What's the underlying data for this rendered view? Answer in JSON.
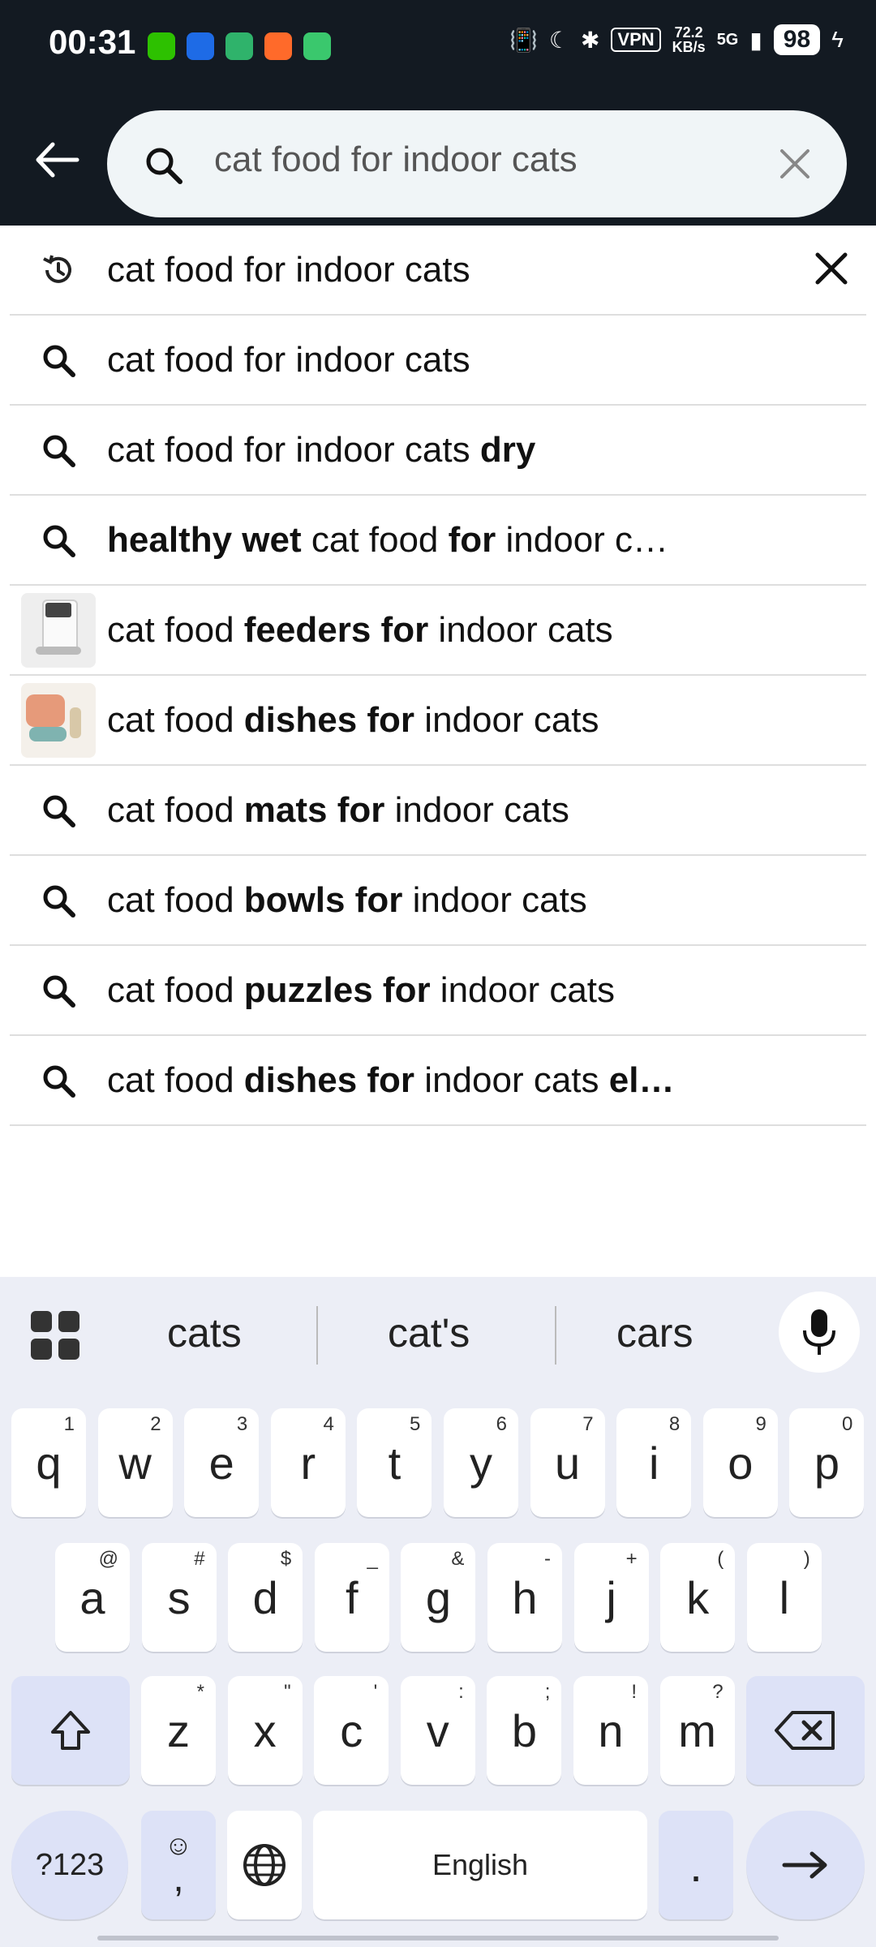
{
  "status_bar": {
    "time": "00:31",
    "vpn": "VPN",
    "speed_value": "72.2",
    "speed_unit": "KB/s",
    "network": "5G",
    "battery": "98"
  },
  "search": {
    "query": "cat food for indoor cats"
  },
  "suggestions": [
    {
      "type": "history",
      "parts": [
        {
          "t": "cat food for indoor cats",
          "b": false
        }
      ],
      "trailing": "remove"
    },
    {
      "type": "search",
      "parts": [
        {
          "t": "cat food for indoor cats",
          "b": false
        }
      ]
    },
    {
      "type": "search",
      "parts": [
        {
          "t": "cat food for indoor cats ",
          "b": false
        },
        {
          "t": "dry",
          "b": true
        }
      ]
    },
    {
      "type": "search",
      "parts": [
        {
          "t": "healthy wet",
          "b": true
        },
        {
          "t": " cat food ",
          "b": false
        },
        {
          "t": "for",
          "b": true
        },
        {
          "t": " indoor c…",
          "b": false
        }
      ]
    },
    {
      "type": "image-feeder",
      "parts": [
        {
          "t": "cat food ",
          "b": false
        },
        {
          "t": "feeders for",
          "b": true
        },
        {
          "t": " indoor cats",
          "b": false
        }
      ]
    },
    {
      "type": "image-dish",
      "parts": [
        {
          "t": "cat food ",
          "b": false
        },
        {
          "t": "dishes for",
          "b": true
        },
        {
          "t": " indoor cats",
          "b": false
        }
      ]
    },
    {
      "type": "search",
      "parts": [
        {
          "t": "cat food ",
          "b": false
        },
        {
          "t": "mats for",
          "b": true
        },
        {
          "t": " indoor cats",
          "b": false
        }
      ]
    },
    {
      "type": "search",
      "parts": [
        {
          "t": "cat food ",
          "b": false
        },
        {
          "t": "bowls for",
          "b": true
        },
        {
          "t": " indoor cats",
          "b": false
        }
      ]
    },
    {
      "type": "search",
      "parts": [
        {
          "t": "cat food ",
          "b": false
        },
        {
          "t": "puzzles for",
          "b": true
        },
        {
          "t": " indoor cats",
          "b": false
        }
      ]
    },
    {
      "type": "search",
      "parts": [
        {
          "t": "cat food ",
          "b": false
        },
        {
          "t": "dishes for",
          "b": true
        },
        {
          "t": " indoor cats ",
          "b": false
        },
        {
          "t": "el…",
          "b": true
        }
      ]
    }
  ],
  "keyboard": {
    "suggestions": [
      "cats",
      "cat's",
      "cars"
    ],
    "row1": [
      [
        "q",
        "1"
      ],
      [
        "w",
        "2"
      ],
      [
        "e",
        "3"
      ],
      [
        "r",
        "4"
      ],
      [
        "t",
        "5"
      ],
      [
        "y",
        "6"
      ],
      [
        "u",
        "7"
      ],
      [
        "i",
        "8"
      ],
      [
        "o",
        "9"
      ],
      [
        "p",
        "0"
      ]
    ],
    "row2": [
      [
        "a",
        "@"
      ],
      [
        "s",
        "#"
      ],
      [
        "d",
        "$"
      ],
      [
        "f",
        "_"
      ],
      [
        "g",
        "&"
      ],
      [
        "h",
        "-"
      ],
      [
        "j",
        "+"
      ],
      [
        "k",
        "("
      ],
      [
        "l",
        ")"
      ]
    ],
    "row3": [
      [
        "z",
        "*"
      ],
      [
        "x",
        "\""
      ],
      [
        "c",
        "'"
      ],
      [
        "v",
        ":"
      ],
      [
        "b",
        ";"
      ],
      [
        "n",
        "!"
      ],
      [
        "m",
        "?"
      ]
    ],
    "symbols_label": "?123",
    "comma_label": ",",
    "space_label": "English",
    "period_label": "."
  },
  "colors": {
    "header_bg": "#131a22",
    "search_bg": "#f0f5f7",
    "keyboard_bg": "#eceef6",
    "fn_key_bg": "#dde2f7"
  }
}
